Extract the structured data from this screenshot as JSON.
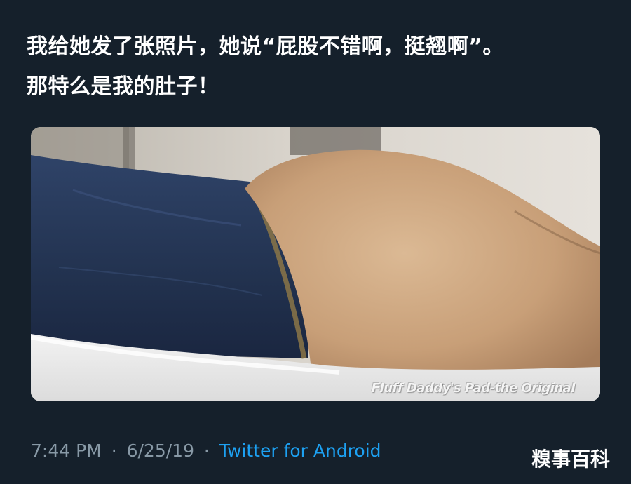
{
  "tweet": {
    "text_line_1": "我给她发了张照片，她说“屁股不错啊，挺翘啊”。",
    "text_line_2": "那特么是我的肚子！",
    "time": "7:44 PM",
    "separator_1": "·",
    "date": "6/25/19",
    "separator_2": "·",
    "source": "Twitter for Android"
  },
  "media": {
    "watermark": "Fluff Daddy's Pad-the Original"
  },
  "logo": {
    "text": "糗事百科"
  },
  "colors": {
    "background": "#15202b",
    "text": "#ffffff",
    "meta": "#8899a6",
    "link": "#1da1f2"
  }
}
